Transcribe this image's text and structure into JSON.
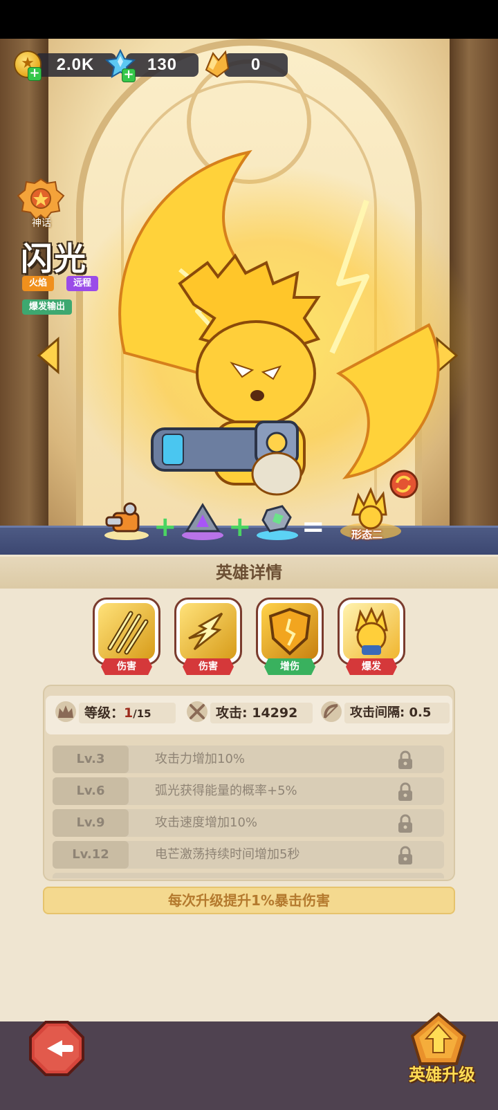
{
  "currency": {
    "gold": "2.0K",
    "gems": "130",
    "crystals": "0"
  },
  "hero": {
    "rarity": "神话",
    "name": "闪光",
    "tags": [
      "火焰",
      "远程",
      "爆发输出"
    ]
  },
  "evolution": {
    "result_label": "形态二"
  },
  "panel": {
    "title": "英雄详情",
    "skills": [
      {
        "tag": "伤害",
        "tag_color": "#d5383a",
        "icon": "claw-strike-icon"
      },
      {
        "tag": "伤害",
        "tag_color": "#d5383a",
        "icon": "lightning-dash-icon"
      },
      {
        "tag": "增伤",
        "tag_color": "#39b15e",
        "icon": "shield-crack-icon"
      },
      {
        "tag": "爆发",
        "tag_color": "#d5383a",
        "icon": "hero-burst-icon"
      }
    ],
    "stats": {
      "level_label": "等级：",
      "level_value": "1",
      "level_max": "/15",
      "attack_label": "攻击: ",
      "attack_value": "14292",
      "interval_label": "攻击间隔: ",
      "interval_value": "0.5"
    },
    "level_rewards": [
      {
        "level": "Lv.3",
        "text": "攻击力增加10%",
        "locked": true
      },
      {
        "level": "Lv.6",
        "text": "弧光获得能量的概率+5%",
        "locked": true
      },
      {
        "level": "Lv.9",
        "text": "攻击速度增加10%",
        "locked": true
      },
      {
        "level": "Lv.12",
        "text": "电芒激荡持续时间增加5秒",
        "locked": true
      }
    ],
    "bonus_text": "每次升级提升1%暴击伤害"
  },
  "bottom": {
    "upgrade_label": "英雄升级"
  },
  "colors": {
    "accent_gold": "#ffdd55",
    "tag_red": "#d5383a",
    "tag_green": "#39b15e",
    "panel_bg": "#efe5d1"
  }
}
